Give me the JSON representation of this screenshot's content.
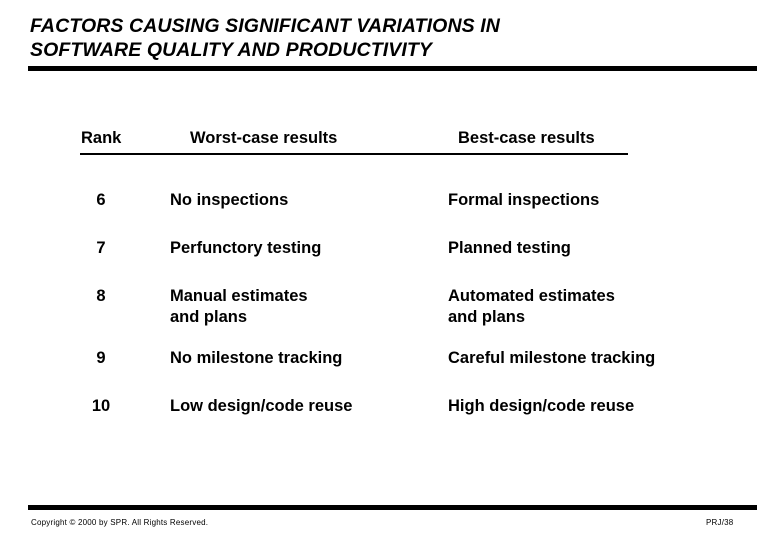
{
  "slide": {
    "title_lines": [
      "FACTORS CAUSING SIGNIFICANT VARIATIONS IN",
      "SOFTWARE QUALITY AND PRODUCTIVITY"
    ],
    "accent_color": "#000000",
    "background_color": "#ffffff"
  },
  "table": {
    "headers": {
      "rank": "Rank",
      "worst": "Worst-case results",
      "best": "Best-case results"
    },
    "rows": [
      {
        "rank": "6",
        "worst": "No inspections",
        "best": "Formal inspections"
      },
      {
        "rank": "7",
        "worst": "Perfunctory testing",
        "best": "Planned testing"
      },
      {
        "rank": "8",
        "worst": "Manual estimates\nand plans",
        "best": "Automated estimates\nand plans"
      },
      {
        "rank": "9",
        "worst": "No milestone tracking",
        "best": "Careful milestone tracking"
      },
      {
        "rank": "10",
        "worst": "Low design/code reuse",
        "best": "High design/code reuse"
      }
    ]
  },
  "footer": {
    "copyright": "Copyright © 2000 by SPR. All Rights Reserved.",
    "page_label": "PRJ/38"
  }
}
